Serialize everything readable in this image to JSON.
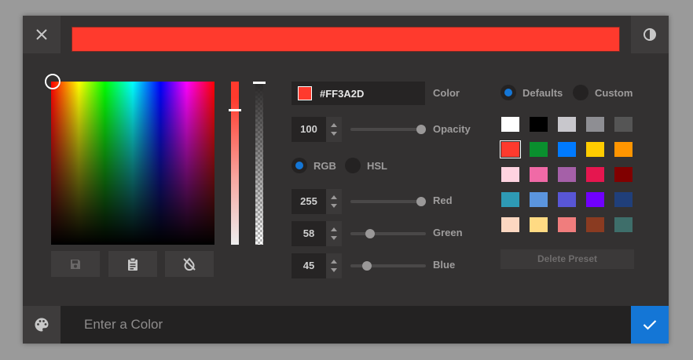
{
  "header": {
    "close_icon": "close-icon",
    "contrast_icon": "contrast-icon",
    "preview_color": "#FF3A2D"
  },
  "picker": {
    "tools": [
      {
        "name": "save-preset-button",
        "icon": "save-icon"
      },
      {
        "name": "paste-button",
        "icon": "clipboard-icon"
      },
      {
        "name": "no-color-button",
        "icon": "invert-colors-off-icon"
      }
    ]
  },
  "controls": {
    "hex_value": "#FF3A2D",
    "color_label": "Color",
    "opacity_value": "100",
    "opacity_label": "Opacity",
    "opacity_fraction": 1.0,
    "mode_rgb": "RGB",
    "mode_hsl": "HSL",
    "selected_mode": "RGB",
    "red_value": "255",
    "red_label": "Red",
    "red_fraction": 1.0,
    "green_value": "58",
    "green_label": "Green",
    "green_fraction": 0.227,
    "blue_value": "45",
    "blue_label": "Blue",
    "blue_fraction": 0.176
  },
  "presets": {
    "defaults_label": "Defaults",
    "custom_label": "Custom",
    "selected_tab": "Defaults",
    "swatches": [
      "#FFFFFF",
      "#000000",
      "#C8C7CC",
      "#8E8E93",
      "#555555",
      "#FF3A2D",
      "#0A8F2E",
      "#007AFF",
      "#FFCC00",
      "#FF9500",
      "#FFD3E0",
      "#F06AA6",
      "#A560A8",
      "#E5164F",
      "#800000",
      "#2E9AB5",
      "#5B95DE",
      "#5856D6",
      "#7000FF",
      "#203F7A",
      "#FCD7C1",
      "#FFDA83",
      "#F07D7D",
      "#8A3B21",
      "#3E6E6A"
    ],
    "selected_swatch": "#FF3A2D",
    "delete_label": "Delete Preset"
  },
  "footer": {
    "palette_icon": "palette-icon",
    "input_placeholder": "Enter a Color",
    "input_value": "",
    "confirm_icon": "check-icon"
  }
}
